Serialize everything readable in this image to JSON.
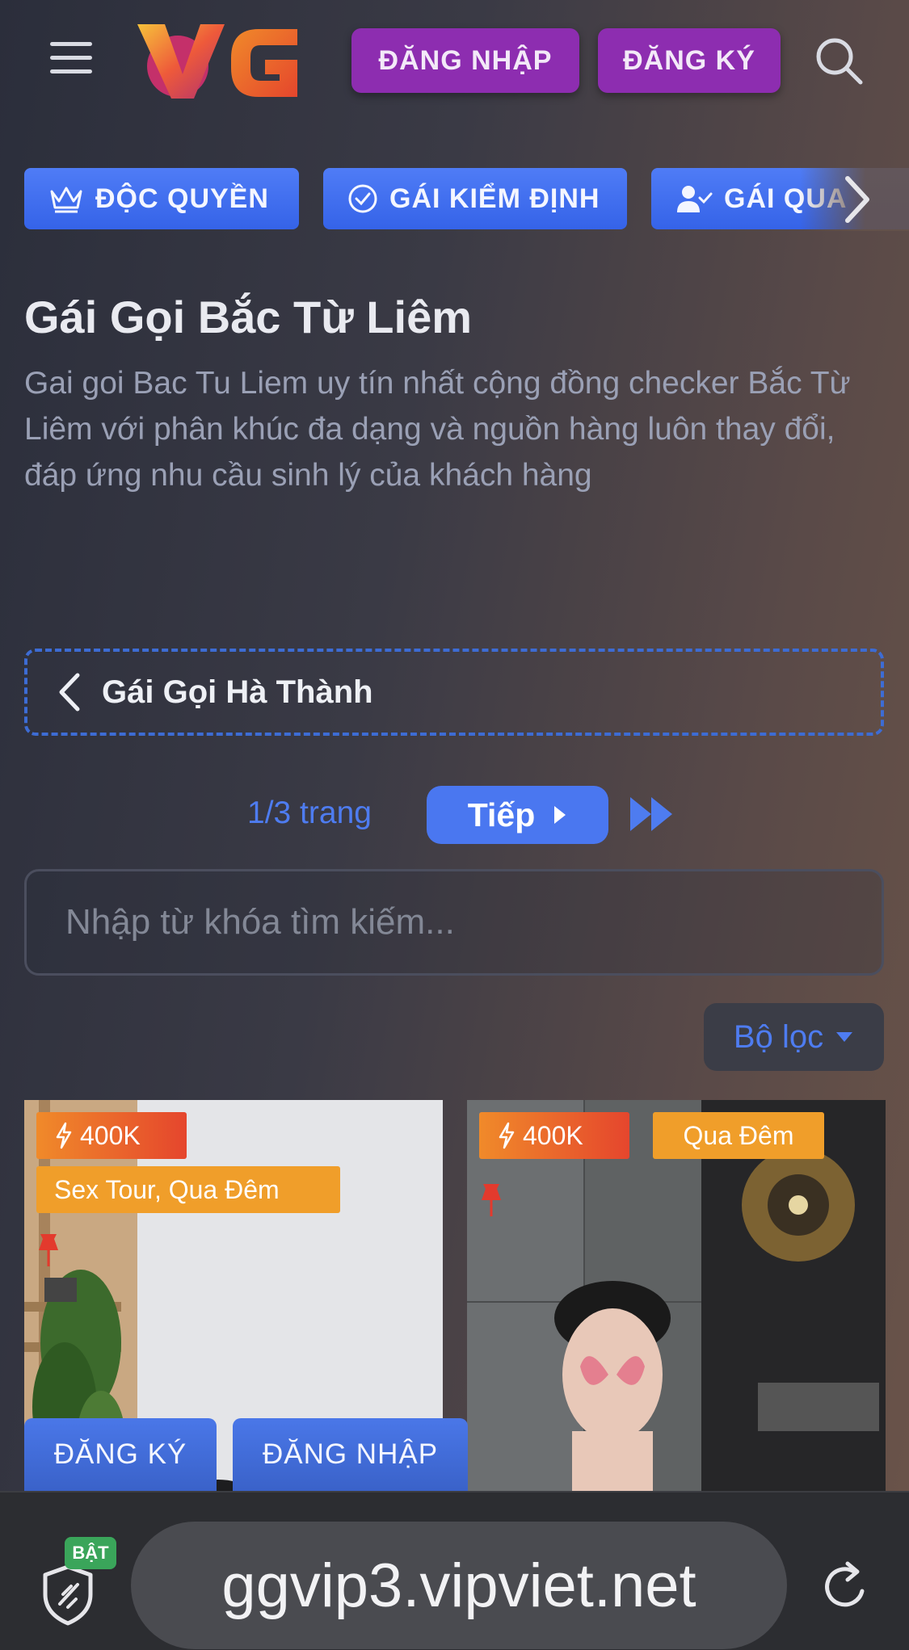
{
  "header": {
    "logo_text": "VG",
    "login_label": "ĐĂNG NHẬP",
    "register_label": "ĐĂNG KÝ"
  },
  "categories": [
    {
      "label": "ĐỘC QUYỀN",
      "icon": "crown-icon"
    },
    {
      "label": "GÁI KIỂM ĐỊNH",
      "icon": "check-circle-icon"
    },
    {
      "label": "GÁI QUA",
      "icon": "user-check-icon"
    }
  ],
  "page": {
    "title": "Gái Gọi Bắc Từ Liêm",
    "description": "Gai goi Bac Tu Liem uy tín nhất cộng đồng checker Bắc Từ Liêm với phân khúc đa dạng và nguồn hàng luôn thay đổi, đáp ứng nhu cầu sinh lý của khách hàng"
  },
  "back_link": {
    "label": "Gái Gọi Hà Thành"
  },
  "pagination": {
    "status": "1/3 trang",
    "next_label": "Tiếp"
  },
  "search": {
    "placeholder": "Nhập từ khóa tìm kiếm..."
  },
  "filter": {
    "label": "Bộ lọc"
  },
  "cards": [
    {
      "price": "400K",
      "tags": "Sex Tour, Qua Đêm"
    },
    {
      "price": "400K",
      "tags": "Qua Đêm"
    }
  ],
  "card_actions": {
    "register_label": "ĐĂNG KÝ",
    "login_label": "ĐĂNG NHẬP"
  },
  "browser": {
    "url": "ggvip3.vipviet.net",
    "shield_badge": "BẬT"
  },
  "colors": {
    "accent_blue": "#4a77f0",
    "purple": "#8d2db0",
    "badge_orange": "#f09e2a",
    "badge_red": "#e5462d",
    "on_green": "#3aa55a"
  }
}
